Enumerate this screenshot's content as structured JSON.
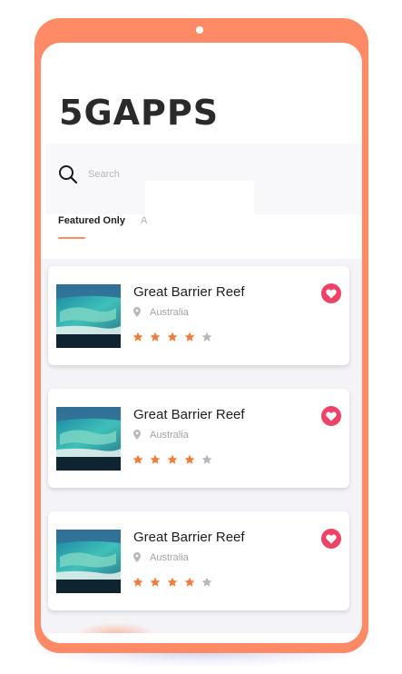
{
  "app": {
    "brand": "5GAPPS"
  },
  "search": {
    "placeholder": "Search"
  },
  "tabs": [
    {
      "label": "Featured Only",
      "active": true
    },
    {
      "label": "A",
      "active": false
    }
  ],
  "places": [
    {
      "name": "Great Barrier Reef",
      "location": "Australia",
      "rating": 4,
      "max_rating": 5,
      "favorited": true
    },
    {
      "name": "Great Barrier Reef",
      "location": "Australia",
      "rating": 4,
      "max_rating": 5,
      "favorited": true
    },
    {
      "name": "Great Barrier Reef",
      "location": "Australia",
      "rating": 4,
      "max_rating": 5,
      "favorited": true
    }
  ],
  "icons": {
    "search": "search-icon",
    "location": "map-pin-icon",
    "star": "star-icon",
    "favorite": "heart-icon"
  },
  "colors": {
    "device_frame": "#ff8a65",
    "accent": "#ff8a65",
    "star_filled": "#ef7d3c",
    "star_empty": "#b8b8b8",
    "favorite": "#ee4266"
  }
}
